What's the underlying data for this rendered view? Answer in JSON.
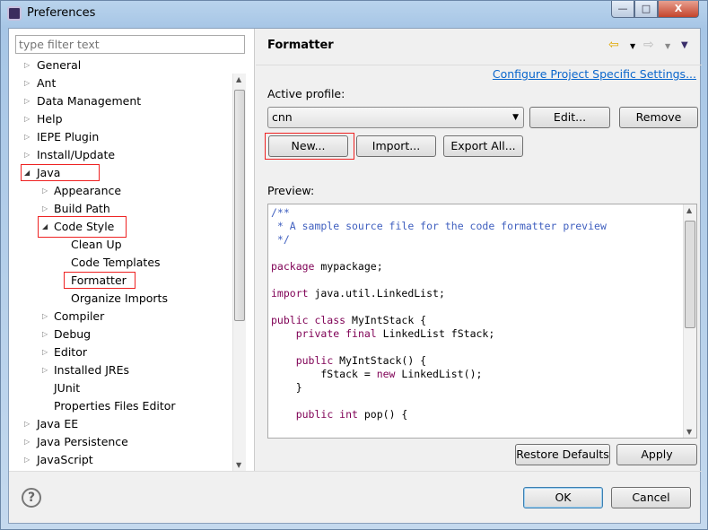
{
  "window": {
    "title": "Preferences",
    "minimize": "—",
    "maximize": "□",
    "close": "X"
  },
  "filter": {
    "placeholder": "type filter text"
  },
  "tree": [
    {
      "label": "General",
      "level": 0,
      "arrow": "collapsed"
    },
    {
      "label": "Ant",
      "level": 0,
      "arrow": "collapsed"
    },
    {
      "label": "Data Management",
      "level": 0,
      "arrow": "collapsed"
    },
    {
      "label": "Help",
      "level": 0,
      "arrow": "collapsed"
    },
    {
      "label": "IEPE Plugin",
      "level": 0,
      "arrow": "collapsed"
    },
    {
      "label": "Install/Update",
      "level": 0,
      "arrow": "collapsed"
    },
    {
      "label": "Java",
      "level": 0,
      "arrow": "expanded",
      "highlighted": true
    },
    {
      "label": "Appearance",
      "level": 1,
      "arrow": "collapsed"
    },
    {
      "label": "Build Path",
      "level": 1,
      "arrow": "collapsed"
    },
    {
      "label": "Code Style",
      "level": 1,
      "arrow": "expanded",
      "highlighted": true
    },
    {
      "label": "Clean Up",
      "level": 2,
      "arrow": "none"
    },
    {
      "label": "Code Templates",
      "level": 2,
      "arrow": "none"
    },
    {
      "label": "Formatter",
      "level": 2,
      "arrow": "none",
      "highlighted": true,
      "selected": true
    },
    {
      "label": "Organize Imports",
      "level": 2,
      "arrow": "none"
    },
    {
      "label": "Compiler",
      "level": 1,
      "arrow": "collapsed"
    },
    {
      "label": "Debug",
      "level": 1,
      "arrow": "collapsed"
    },
    {
      "label": "Editor",
      "level": 1,
      "arrow": "collapsed"
    },
    {
      "label": "Installed JREs",
      "level": 1,
      "arrow": "collapsed"
    },
    {
      "label": "JUnit",
      "level": 1,
      "arrow": "none"
    },
    {
      "label": "Properties Files Editor",
      "level": 1,
      "arrow": "none"
    },
    {
      "label": "Java EE",
      "level": 0,
      "arrow": "collapsed"
    },
    {
      "label": "Java Persistence",
      "level": 0,
      "arrow": "collapsed"
    },
    {
      "label": "JavaScript",
      "level": 0,
      "arrow": "collapsed"
    }
  ],
  "page": {
    "title": "Formatter",
    "nav": {
      "back": "⇦",
      "forward": "⇨",
      "menu": "▼"
    },
    "configure_link": "Configure Project Specific Settings...",
    "active_profile_label": "Active profile:",
    "profile_value": "cnn",
    "buttons": {
      "edit": "Edit...",
      "remove": "Remove",
      "new": "New...",
      "import": "Import...",
      "export_all": "Export All..."
    },
    "preview_label": "Preview:",
    "code": [
      [
        [
          "/**",
          "cm"
        ]
      ],
      [
        [
          " * A sample source file for the code formatter preview",
          "cm"
        ]
      ],
      [
        [
          " */",
          "cm"
        ]
      ],
      [],
      [
        [
          "package",
          "kw"
        ],
        [
          " mypackage;",
          ""
        ]
      ],
      [],
      [
        [
          "import",
          "kw"
        ],
        [
          " java.util.LinkedList;",
          ""
        ]
      ],
      [],
      [
        [
          "public class",
          "kw"
        ],
        [
          " MyIntStack {",
          ""
        ]
      ],
      [
        [
          "    ",
          ""
        ],
        [
          "private final",
          "kw"
        ],
        [
          " LinkedList fStack;",
          ""
        ]
      ],
      [],
      [
        [
          "    ",
          ""
        ],
        [
          "public",
          "kw"
        ],
        [
          " MyIntStack() {",
          ""
        ]
      ],
      [
        [
          "        fStack = ",
          ""
        ],
        [
          "new",
          "kw"
        ],
        [
          " LinkedList();",
          ""
        ]
      ],
      [
        [
          "    }",
          ""
        ]
      ],
      [],
      [
        [
          "    ",
          ""
        ],
        [
          "public int",
          "kw"
        ],
        [
          " pop() {",
          ""
        ]
      ]
    ],
    "restore_defaults": "Restore Defaults",
    "apply": "Apply"
  },
  "footer": {
    "help": "?",
    "ok": "OK",
    "cancel": "Cancel"
  },
  "colors": {
    "highlight": "#e22222",
    "link": "#0a66cc",
    "comment": "#3f5fbf",
    "keyword": "#7f0055"
  }
}
